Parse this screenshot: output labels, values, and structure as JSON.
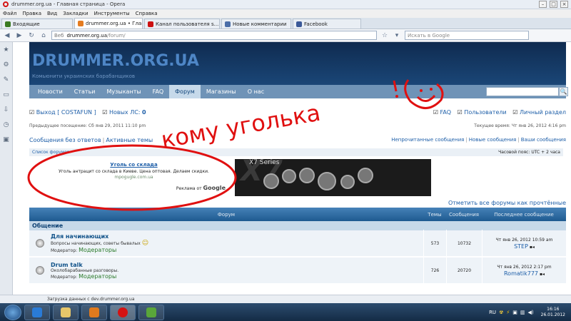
{
  "window": {
    "title": "drummer.org.ua - Главная страница - Opera",
    "controls": [
      "–",
      "□",
      "×"
    ]
  },
  "menu": [
    "Файл",
    "Правка",
    "Вид",
    "Закладки",
    "Инструменты",
    "Справка"
  ],
  "tabs": [
    {
      "label": "Входящие",
      "color": "#3a7a22",
      "active": false
    },
    {
      "label": "drummer.org.ua • Главн...",
      "color": "#e57c20",
      "active": true
    },
    {
      "label": "Канал пользователя s...",
      "color": "#cc1111",
      "active": false
    },
    {
      "label": "Новые комментарии",
      "color": "#4b6ea8",
      "active": false
    },
    {
      "label": "Facebook",
      "color": "#3b5998",
      "active": false
    }
  ],
  "address": {
    "label": "Веб",
    "host": "drummer.org.ua",
    "path": "/forum/"
  },
  "search": {
    "placeholder": "Искать в Google"
  },
  "site": {
    "logo": "DRUMMER.ORG.UA",
    "slogan": "Комьюнити украинских барабанщиков",
    "nav": [
      "Новости",
      "Статьи",
      "Музыканты",
      "FAQ",
      "Форум",
      "Магазины",
      "О нас"
    ],
    "nav_active": "Форум"
  },
  "user": {
    "logout": "Выход [ COSTAFUN ]",
    "pm": "Новых ЛС:",
    "pm_count": "0",
    "faq": "FAQ",
    "users": "Пользователи",
    "personal": "Личный раздел"
  },
  "visit": {
    "last": "Предыдущее посещение: Сб янв 29, 2011 11:10 pm",
    "now": "Текущее время: Чт янв 26, 2012 4:16 pm"
  },
  "links": {
    "left1": "Сообщения без ответов",
    "left2": "Активные темы",
    "right1": "Непрочитанные сообщения",
    "right2": "Новые сообщения",
    "right3": "Ваши сообщения"
  },
  "breadcrumb": {
    "left": "Список форумов",
    "right": "Часовой пояс: UTC + 2 часа"
  },
  "ad": {
    "title": "Уголь со склада",
    "text": "Уголь антрацит со склада в Киеве. Цена оптовая. Делаем скидки.",
    "url": "mpogugle.com.ua",
    "by": "Реклама от",
    "google": "Google",
    "banner": "X7 Series"
  },
  "mark_read": "Отметить все форумы как прочтённые",
  "table": {
    "headers": {
      "forum": "Форум",
      "topics": "Темы",
      "posts": "Сообщения",
      "last": "Последнее сообщение"
    },
    "category": "Общение",
    "rows": [
      {
        "title": "Для начинающих",
        "desc": "Вопросы начинающих, советы бывалых",
        "mod_label": "Модератор:",
        "mod": "Модераторы",
        "topics": "573",
        "posts": "10732",
        "last_date": "Чт янв 26, 2012 10:59 am",
        "last_user": "STEP"
      },
      {
        "title": "Drum talk",
        "desc": "Околобарабанные разговоры.",
        "mod_label": "Модератор:",
        "mod": "Модераторы",
        "topics": "726",
        "posts": "20720",
        "last_date": "Чт янв 26, 2012 2:17 pm",
        "last_user": "Romatik777"
      }
    ]
  },
  "status": "Загрузка данных с dev.drummer.org.ua",
  "tray": {
    "lang": "RU",
    "time": "16:16",
    "date": "26.01.2012"
  },
  "annotation": {
    "text": "кому уголька",
    "color": "#e01010"
  }
}
